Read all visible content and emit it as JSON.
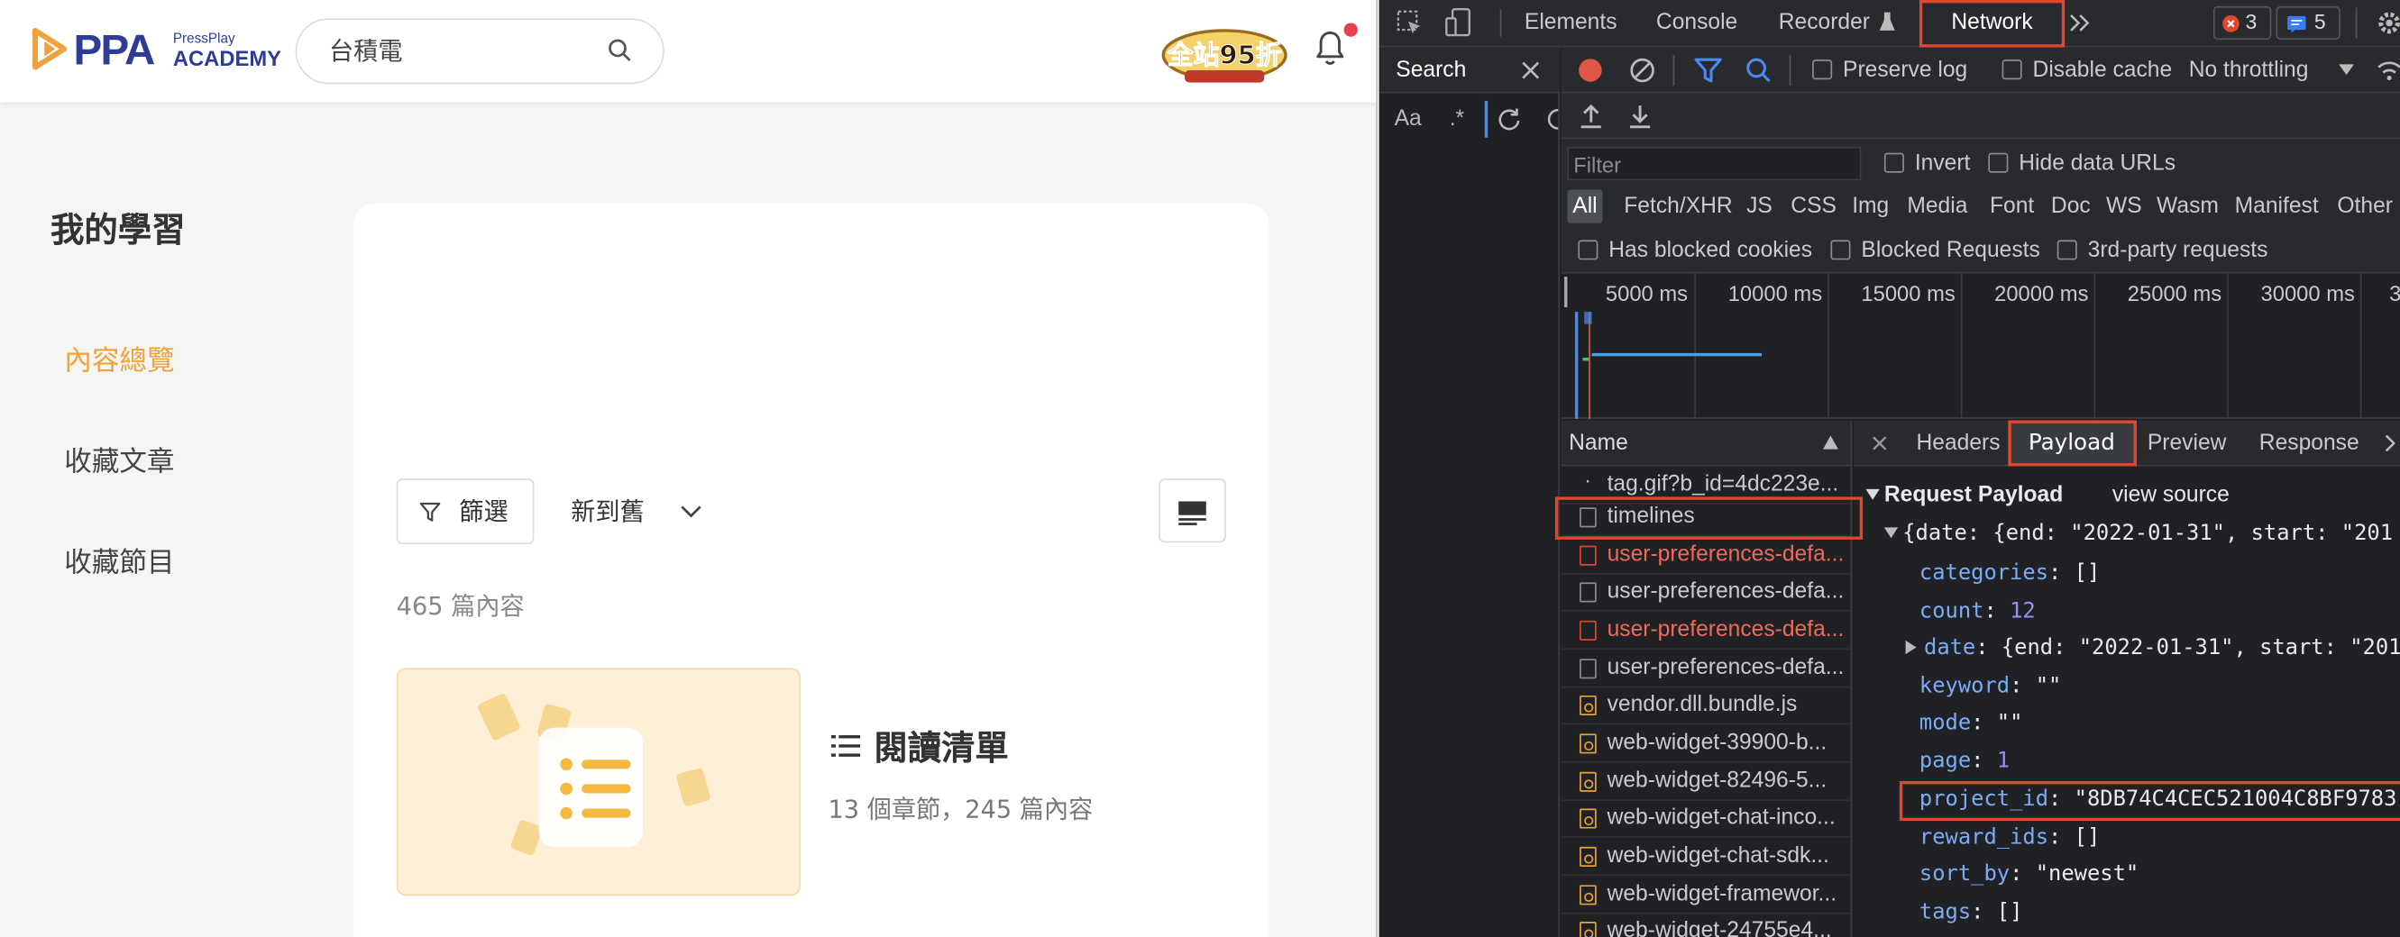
{
  "web": {
    "logo": {
      "brand": "PPA",
      "small": "PressPlay",
      "sub": "ACADEMY"
    },
    "search": {
      "value": "台積電"
    },
    "promo": {
      "text": "全站95折"
    },
    "page_title": "我的學習",
    "sidebar": [
      {
        "label": "內容總覽",
        "active": true
      },
      {
        "label": "收藏文章",
        "active": false
      },
      {
        "label": "收藏節目",
        "active": false
      }
    ],
    "filter_label": "篩選",
    "sort_label": "新到舊",
    "content_count": "465 篇內容",
    "reading_list": {
      "title": "閱讀清單",
      "subtitle": "13 個章節，245 篇內容"
    },
    "colors": {
      "accent": "#f0a13c",
      "brand": "#2d3c96"
    }
  },
  "devtools": {
    "tabs": [
      "Elements",
      "Console",
      "Recorder",
      "Network"
    ],
    "active_tab": "Network",
    "errors": "3",
    "messages": "5",
    "search_tab": "Search",
    "search_opts": [
      "Aa",
      ".*"
    ],
    "toolbar": {
      "preserve_log": "Preserve log",
      "disable_cache": "Disable cache",
      "throttling": "No throttling"
    },
    "filter_placeholder": "Filter",
    "invert": "Invert",
    "hide_data": "Hide data URLs",
    "types": [
      "All",
      "Fetch/XHR",
      "JS",
      "CSS",
      "Img",
      "Media",
      "Font",
      "Doc",
      "WS",
      "Wasm",
      "Manifest",
      "Other"
    ],
    "blocked": [
      "Has blocked cookies",
      "Blocked Requests",
      "3rd-party requests"
    ],
    "timeline_ticks": [
      "5000 ms",
      "10000 ms",
      "15000 ms",
      "20000 ms",
      "25000 ms",
      "30000 ms",
      "3"
    ],
    "name_header": "Name",
    "requests": [
      {
        "name": "tag.gif?b_id=4dc223e...",
        "type": "dot"
      },
      {
        "name": "timelines",
        "type": "doc",
        "highlighted": true
      },
      {
        "name": "user-preferences-defa...",
        "type": "error"
      },
      {
        "name": "user-preferences-defa...",
        "type": "doc"
      },
      {
        "name": "user-preferences-defa...",
        "type": "error"
      },
      {
        "name": "user-preferences-defa...",
        "type": "doc"
      },
      {
        "name": "vendor.dll.bundle.js",
        "type": "js"
      },
      {
        "name": "web-widget-39900-b...",
        "type": "js"
      },
      {
        "name": "web-widget-82496-5...",
        "type": "js"
      },
      {
        "name": "web-widget-chat-inco...",
        "type": "js"
      },
      {
        "name": "web-widget-chat-sdk...",
        "type": "js"
      },
      {
        "name": "web-widget-framewor...",
        "type": "js"
      },
      {
        "name": "web-widget-24755e4...",
        "type": "js"
      }
    ],
    "detail_tabs": [
      "Headers",
      "Payload",
      "Preview",
      "Response"
    ],
    "active_detail_tab": "Payload",
    "payload": {
      "title": "Request Payload",
      "view_source": "view source",
      "summary": "{date: {end: \"2022-01-31\", start: \"201",
      "lines": [
        {
          "key": "categories",
          "value": "[]",
          "kind": "plain"
        },
        {
          "key": "count",
          "value": "12",
          "kind": "num"
        },
        {
          "key": "date",
          "value": "{end: \"2022-01-31\", start: \"201",
          "kind": "obj"
        },
        {
          "key": "keyword",
          "value": "\"\"",
          "kind": "str"
        },
        {
          "key": "mode",
          "value": "\"\"",
          "kind": "str"
        },
        {
          "key": "page",
          "value": "1",
          "kind": "num"
        },
        {
          "key": "project_id",
          "value": "\"8DB74C4CEC521004C8BF9783",
          "kind": "str"
        },
        {
          "key": "reward_ids",
          "value": "[]",
          "kind": "plain"
        },
        {
          "key": "sort_by",
          "value": "\"newest\"",
          "kind": "str"
        },
        {
          "key": "tags",
          "value": "[]",
          "kind": "plain"
        }
      ]
    }
  }
}
